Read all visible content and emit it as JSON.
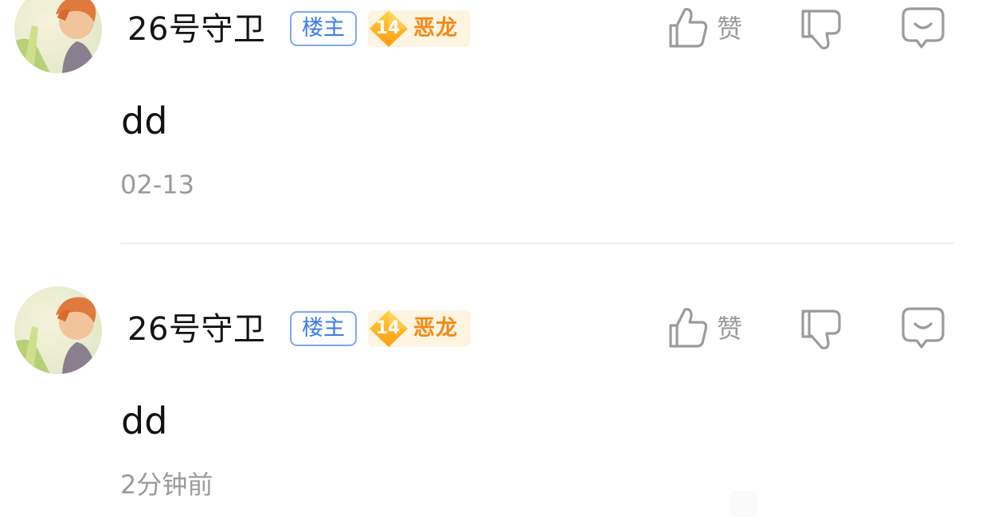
{
  "comments": [
    {
      "username": "26号守卫",
      "owner_badge": "楼主",
      "level": "14",
      "level_name": "恶龙",
      "like_label": "赞",
      "content": "dd",
      "timestamp": "02-13"
    },
    {
      "username": "26号守卫",
      "owner_badge": "楼主",
      "level": "14",
      "level_name": "恶龙",
      "like_label": "赞",
      "content": "dd",
      "timestamp": "2分钟前"
    }
  ],
  "colors": {
    "owner_badge": "#3d7ce8",
    "level_badge_bg": "#fdf4e2",
    "level_name": "#f28a16",
    "icon_gray": "#9b9b9b"
  },
  "icons": {
    "like": "thumbs-up-icon",
    "dislike": "thumbs-down-icon",
    "reply": "chat-bubble-icon"
  }
}
